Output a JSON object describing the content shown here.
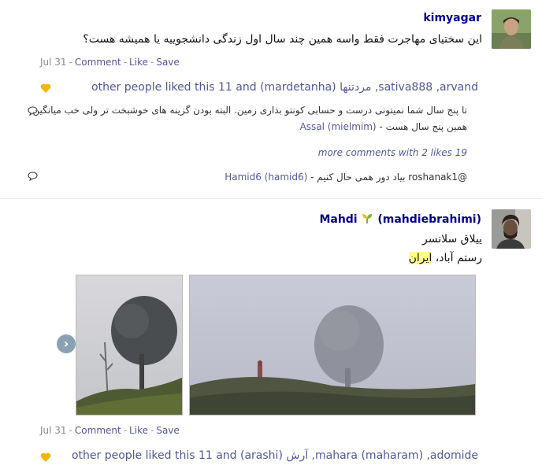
{
  "post1": {
    "author": "kimyagar",
    "text": "این سختیای مهاجرت فقط واسه همین چند سال اول زندگی دانشجوییه یا همیشه هست؟",
    "meta": {
      "date": "Jul 31",
      "comment": "Comment",
      "like": "Like",
      "save": "Save"
    },
    "likes": {
      "names": "other people liked this 11 and (mardetanha) مردتنها ,sativa888 ,arvand"
    },
    "comments": [
      {
        "text": "تا پنج سال شما نمیتونی درست و حسابی کونتو بذاری زمین. البته بودن گزینه های خوشبخت تر ولی خب میانگین همین پنج سال هست - ",
        "who": "Assal (mielmim)"
      },
      {
        "text": "@roshanak1 بیاد دور همی حال کنیم - ",
        "who": "Hamid6 (hamid6)"
      }
    ],
    "more_comments": "more comments with 2 likes 19"
  },
  "post2": {
    "author_name": "Mahdi",
    "author_handle": "(mahdiebrahimi)",
    "line1": "ییلاق سلانسر",
    "line2_prefix": "رستم آباد، ",
    "line2_highlight": "ایران",
    "meta": {
      "date": "Jul 31",
      "comment": "Comment",
      "like": "Like",
      "save": "Save"
    },
    "likes": {
      "names": "other people liked this 11 and (arashi) آرش ,mahara (maharam) ,adomide"
    }
  },
  "icons": {
    "heart": "heart-icon",
    "comment": "comment-bubble-icon",
    "next": "chevron-right-icon"
  },
  "colors": {
    "link": "#555599",
    "author": "#000088",
    "heart": "#f2b705",
    "highlight": "#ffff88"
  }
}
